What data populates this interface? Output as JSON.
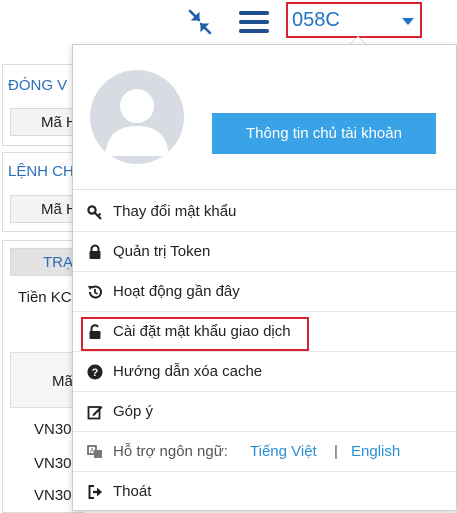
{
  "header": {
    "account_id": "058C"
  },
  "background": {
    "section1_title": "ĐÓNG V",
    "section1_cell": "Mã H",
    "section2_title": "LỆNH CH",
    "section2_cell": "Mã H",
    "section3_tab": "TRẠ",
    "section3_row": "Tiền KC",
    "table_header": "Mã",
    "rows": [
      "VN30",
      "VN30",
      "VN30"
    ]
  },
  "account_panel": {
    "account_info_button": "Thông tin chủ tài khoản",
    "menu": [
      {
        "label": "Thay đổi mật khẩu",
        "icon": "key-icon"
      },
      {
        "label": "Quản trị Token",
        "icon": "lock-icon"
      },
      {
        "label": "Hoạt động gần đây",
        "icon": "history-icon"
      },
      {
        "label": "Cài đặt mật khẩu giao dịch",
        "icon": "unlock-icon"
      },
      {
        "label": "Hướng dẫn xóa cache",
        "icon": "question-icon"
      },
      {
        "label": "Góp ý",
        "icon": "edit-icon"
      }
    ],
    "language": {
      "label": "Hỗ trợ ngôn ngữ:",
      "options": [
        "Tiếng Việt",
        "English"
      ],
      "separator": "|"
    },
    "logout": "Thoát"
  },
  "colors": {
    "accent": "#3aa2e6",
    "link": "#2a8fd6",
    "highlight": "#d9232e",
    "account_id": "#1f72c4"
  }
}
